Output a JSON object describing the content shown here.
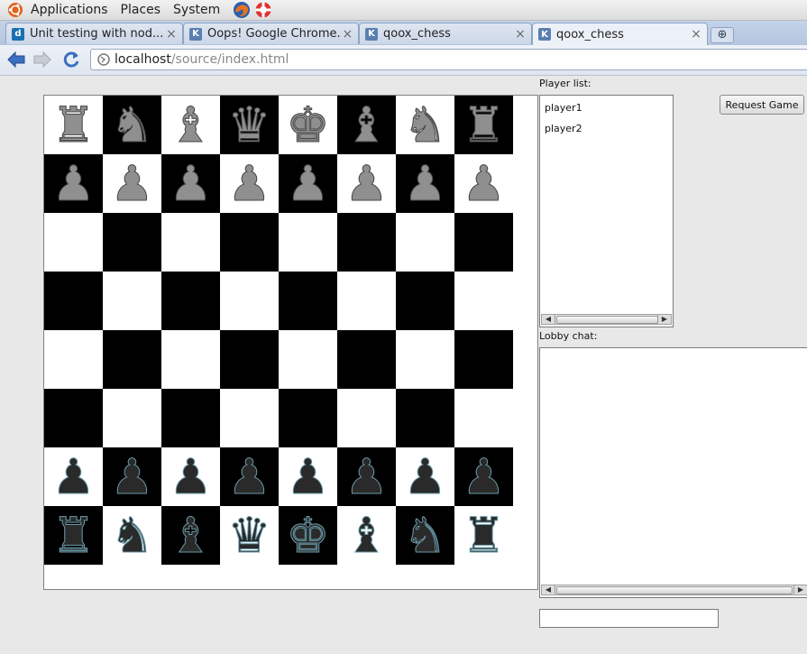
{
  "panel": {
    "menus": [
      "Applications",
      "Places",
      "System"
    ]
  },
  "tabs": [
    {
      "title": "Unit testing with nod...",
      "favicon": "d",
      "favicon_color": "#1a6fb3"
    },
    {
      "title": "Oops! Google Chrome...",
      "favicon": "K",
      "favicon_color": "#5a7fb0"
    },
    {
      "title": "qoox_chess",
      "favicon": "K",
      "favicon_color": "#5a7fb0"
    },
    {
      "title": "qoox_chess",
      "favicon": "K",
      "favicon_color": "#5a7fb0",
      "active": true
    }
  ],
  "toolbar": {
    "url_host": "localhost",
    "url_path": "/source/index.html"
  },
  "board": {
    "light_color": "#ffffff",
    "dark_color": "#000000",
    "rows": [
      [
        "♜",
        "♞",
        "♝",
        "♛",
        "♚",
        "♝",
        "♞",
        "♜"
      ],
      [
        "♟",
        "♟",
        "♟",
        "♟",
        "♟",
        "♟",
        "♟",
        "♟"
      ],
      [
        "",
        "",
        "",
        "",
        "",
        "",
        "",
        ""
      ],
      [
        "",
        "",
        "",
        "",
        "",
        "",
        "",
        ""
      ],
      [
        "",
        "",
        "",
        "",
        "",
        "",
        "",
        ""
      ],
      [
        "",
        "",
        "",
        "",
        "",
        "",
        "",
        ""
      ],
      [
        "♟",
        "♟",
        "♟",
        "♟",
        "♟",
        "♟",
        "♟",
        "♟"
      ],
      [
        "♜",
        "♞",
        "♝",
        "♛",
        "♚",
        "♝",
        "♞",
        "♜"
      ]
    ],
    "row_colors": [
      "gray",
      "gray",
      "",
      "",
      "",
      "",
      "black",
      "black"
    ]
  },
  "sidebar": {
    "player_list_label": "Player list:",
    "players": [
      "player1",
      "player2"
    ],
    "lobby_chat_label": "Lobby chat:",
    "request_game_label": "Request Game",
    "chat_input_value": ""
  }
}
